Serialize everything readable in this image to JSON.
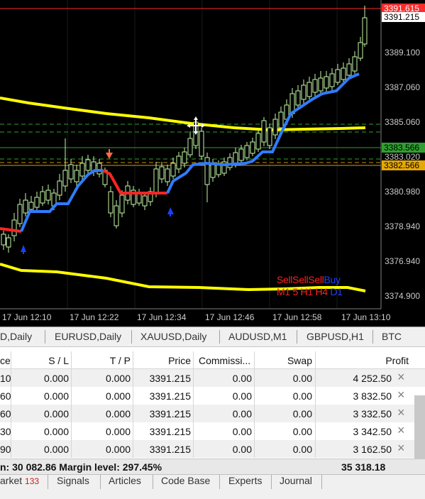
{
  "chart": {
    "price_labels": [
      "3389.100",
      "3387.060",
      "3385.060",
      "3383.020",
      "3380.980",
      "3378.940",
      "3376.940",
      "3374.900"
    ],
    "tag_ask": "3391.615",
    "tag_bid": "3391.215",
    "tag_level_green": "3383.566",
    "tag_level_yellow": "3382.566",
    "time_labels": [
      "17 Jun 12:10",
      "17 Jun 12:22",
      "17 Jun 12:34",
      "17 Jun 12:46",
      "17 Jun 12:58",
      "17 Jun 13:10"
    ],
    "signal_words": [
      "Sell",
      "Sell",
      "Sell",
      "Buy"
    ],
    "signal_tfs": [
      "M1",
      "5",
      "H1",
      "H4",
      "D1"
    ],
    "colors": {
      "background": "#000000",
      "candle": "#c6f7a8",
      "trend_up": "#2f7cff",
      "trend_down": "#ff2424",
      "envelope": "#ffff00",
      "ask_line": "#ff2a2a",
      "green_level": "#2fa02f",
      "yellow_level": "#d4a000",
      "arrow_up": "#1a40ff",
      "arrow_down": "#ff6a4a"
    }
  },
  "symbol_tabs": [
    "D,Daily",
    "EURUSD,Daily",
    "XAUUSD,Daily",
    "AUDUSD,M1",
    "GBPUSD,H1",
    "BTC"
  ],
  "table": {
    "headers": [
      "ce",
      "S / L",
      "T / P",
      "Price",
      "Commissi...",
      "Swap",
      "Profit"
    ],
    "rows": [
      [
        "10",
        "0.000",
        "0.000",
        "3391.215",
        "0.00",
        "0.00",
        "4 252.50"
      ],
      [
        "60",
        "0.000",
        "0.000",
        "3391.215",
        "0.00",
        "0.00",
        "3 832.50"
      ],
      [
        "60",
        "0.000",
        "0.000",
        "3391.215",
        "0.00",
        "0.00",
        "3 332.50"
      ],
      [
        "30",
        "0.000",
        "0.000",
        "3391.215",
        "0.00",
        "0.00",
        "3 342.50"
      ],
      [
        "90",
        "0.000",
        "0.000",
        "3391.215",
        "0.00",
        "0.00",
        "3 162.50"
      ]
    ],
    "close_icon": "×"
  },
  "summary": {
    "left_text": "n: 30 082.86  Margin level: 297.45%",
    "total_profit": "35 318.18"
  },
  "bottom_tabs": {
    "market_label": "arket",
    "market_badge": "133",
    "tabs": [
      "Signals",
      "Articles",
      "Code Base",
      "Experts",
      "Journal"
    ]
  }
}
